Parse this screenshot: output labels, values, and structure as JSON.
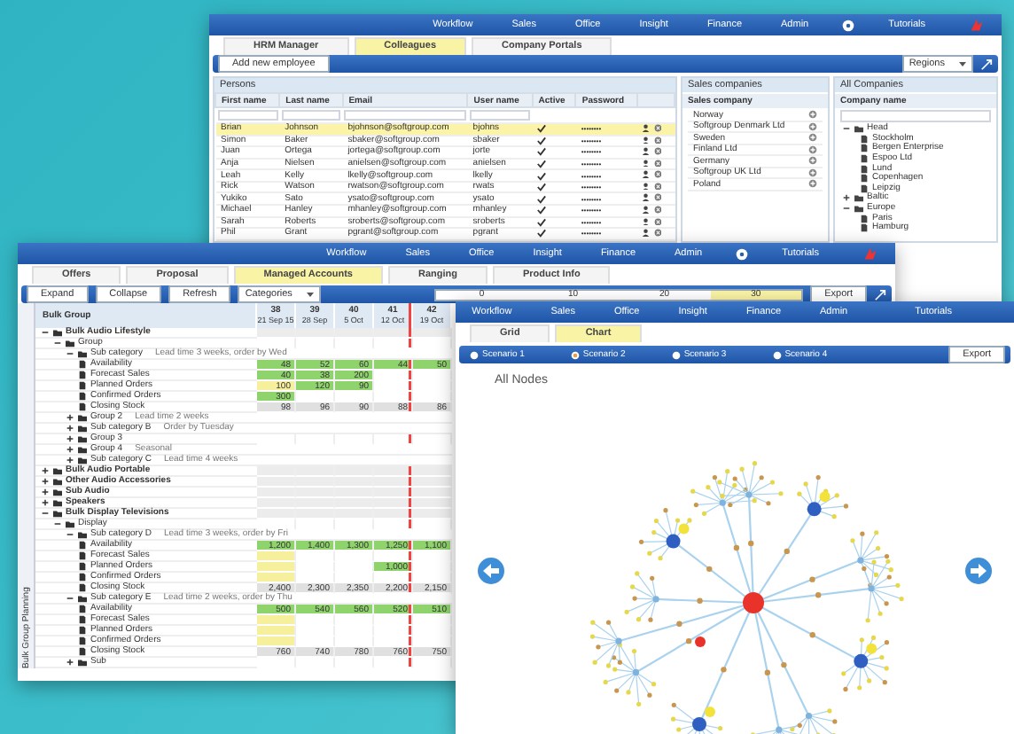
{
  "windows": [
    {
      "kind": "people",
      "menu": [
        "Workflow",
        "Sales",
        "Office",
        "Insight",
        "Finance",
        "Admin",
        "Tutorials"
      ],
      "tabs": [
        {
          "label": "HRM Manager",
          "selected": false
        },
        {
          "label": "Colleagues",
          "selected": true
        },
        {
          "label": "Company Portals",
          "selected": false
        }
      ],
      "toolbar": {
        "button": "Add new employee",
        "dropdown": "Regions"
      },
      "persons": {
        "title": "Persons",
        "columns": [
          "First name",
          "Last name",
          "Email",
          "User name",
          "Active",
          "Password"
        ],
        "rows": [
          {
            "cells": [
              "Brian",
              "Johnson",
              "bjohnson@softgroup.com",
              "bjohns"
            ],
            "active": true,
            "password": "••••••••",
            "selected": true
          },
          {
            "cells": [
              "Simon",
              "Baker",
              "sbaker@softgroup.com",
              "sbaker"
            ],
            "active": true,
            "password": "••••••••",
            "selected": false
          },
          {
            "cells": [
              "Juan",
              "Ortega",
              "jortega@softgroup.com",
              "jorte"
            ],
            "active": true,
            "password": "••••••••",
            "selected": false
          },
          {
            "cells": [
              "Anja",
              "Nielsen",
              "anielsen@softgroup.com",
              "anielsen"
            ],
            "active": true,
            "password": "••••••••",
            "selected": false
          },
          {
            "cells": [
              "Leah",
              "Kelly",
              "lkelly@softgroup.com",
              "lkelly"
            ],
            "active": true,
            "password": "••••••••",
            "selected": false
          },
          {
            "cells": [
              "Rick",
              "Watson",
              "rwatson@softgroup.com",
              "rwats"
            ],
            "active": true,
            "password": "••••••••",
            "selected": false
          },
          {
            "cells": [
              "Yukiko",
              "Sato",
              "ysato@softgroup.com",
              "ysato"
            ],
            "active": true,
            "password": "••••••••",
            "selected": false
          },
          {
            "cells": [
              "Michael",
              "Hanley",
              "mhanley@softgroup.com",
              "mhanley"
            ],
            "active": true,
            "password": "••••••••",
            "selected": false
          },
          {
            "cells": [
              "Sarah",
              "Roberts",
              "sroberts@softgroup.com",
              "sroberts"
            ],
            "active": true,
            "password": "••••••••",
            "selected": false
          },
          {
            "cells": [
              "Phil",
              "Grant",
              "pgrant@softgroup.com",
              "pgrant"
            ],
            "active": true,
            "password": "••••••••",
            "selected": false
          }
        ]
      },
      "sales": {
        "title": "Sales companies",
        "column": "Sales company",
        "items": [
          "Norway",
          "Softgroup Denmark Ltd",
          "Sweden",
          "Finland Ltd",
          "Germany",
          "Softgroup UK Ltd",
          "Poland"
        ]
      },
      "companies": {
        "title": "All Companies",
        "column": "Company name",
        "tree": [
          {
            "label": "Head",
            "expanded": true,
            "children": [
              {
                "label": "Stockholm"
              },
              {
                "label": "Bergen Enterprise"
              },
              {
                "label": "Espoo Ltd"
              },
              {
                "label": "Lund"
              },
              {
                "label": "Copenhagen"
              },
              {
                "label": "Leipzig"
              }
            ]
          },
          {
            "label": "Baltic",
            "expanded": false
          },
          {
            "label": "Europe",
            "expanded": true,
            "children": [
              {
                "label": "Paris"
              },
              {
                "label": "Hamburg"
              }
            ]
          }
        ]
      }
    },
    {
      "kind": "planner",
      "menu": [
        "Workflow",
        "Sales",
        "Office",
        "Insight",
        "Finance",
        "Admin",
        "Tutorials"
      ],
      "tabs": [
        {
          "label": "Offers",
          "selected": false
        },
        {
          "label": "Proposal",
          "selected": false
        },
        {
          "label": "Managed Accounts",
          "selected": true
        },
        {
          "label": "Ranging",
          "selected": false
        },
        {
          "label": "Product Info",
          "selected": false
        }
      ],
      "toolbar": {
        "buttons": [
          "Expand",
          "Collapse",
          "Refresh"
        ],
        "dropdown": "Categories",
        "scale": [
          "0",
          "10",
          "20",
          "30"
        ],
        "button": "Export"
      },
      "side_label": "Bulk Group Planning",
      "group_header": "Bulk Group",
      "weeks": [
        {
          "week": "38",
          "date": "21 Sep 15",
          "current": false
        },
        {
          "week": "39",
          "date": "28 Sep",
          "current": false
        },
        {
          "week": "40",
          "date": "5 Oct",
          "current": false
        },
        {
          "week": "41",
          "date": "12 Oct",
          "current": true
        },
        {
          "week": "42",
          "date": "19 Oct",
          "current": false
        }
      ],
      "rows": [
        {
          "label": "Bulk Audio Lifestyle",
          "expanded": true,
          "children": [
            {
              "label": "Group",
              "expanded": true,
              "children": [
                {
                  "label": "Sub category",
                  "note": "Lead time 3 weeks, order by Wed",
                  "expanded": true,
                  "children": [
                    {
                      "label": "Availability",
                      "cells": [
                        {
                          "value": "48",
                          "color": "#8fd36c"
                        },
                        {
                          "value": "52",
                          "color": "#8fd36c"
                        },
                        {
                          "value": "60",
                          "color": "#8fd36c"
                        },
                        {
                          "value": "44",
                          "color": "#8fd36c"
                        },
                        {
                          "value": "50",
                          "color": "#8fd36c"
                        }
                      ]
                    },
                    {
                      "label": "Forecast Sales",
                      "cells": [
                        {
                          "value": "40",
                          "color": "#8fd36c"
                        },
                        {
                          "value": "38",
                          "color": "#8fd36c"
                        },
                        {
                          "value": "200",
                          "color": "#8fd36c"
                        },
                        {
                          "color": "#ffffff"
                        },
                        {
                          "color": "#ffffff"
                        }
                      ]
                    },
                    {
                      "label": "Planned Orders",
                      "cells": [
                        {
                          "value": "100",
                          "color": "#f6ef9c"
                        },
                        {
                          "value": "120",
                          "color": "#8fd36c"
                        },
                        {
                          "value": "90",
                          "color": "#8fd36c"
                        },
                        {
                          "color": "#ffffff"
                        },
                        {
                          "color": "#ffffff"
                        }
                      ]
                    },
                    {
                      "label": "Confirmed Orders",
                      "cells": [
                        {
                          "value": "300",
                          "color": "#8fd36c"
                        },
                        {
                          "color": "#ffffff"
                        },
                        {
                          "color": "#ffffff"
                        },
                        {
                          "color": "#ffffff"
                        },
                        {
                          "color": "#ffffff"
                        }
                      ]
                    },
                    {
                      "label": "Closing Stock",
                      "cells": [
                        {
                          "value": "98",
                          "color": "#e0e0e0"
                        },
                        {
                          "value": "96",
                          "color": "#e0e0e0"
                        },
                        {
                          "value": "90",
                          "color": "#e0e0e0"
                        },
                        {
                          "value": "88",
                          "color": "#e0e0e0"
                        },
                        {
                          "value": "86",
                          "color": "#e0e0e0"
                        }
                      ]
                    }
                  ]
                },
                {
                  "label": "Group 2",
                  "note": "Lead time 2 weeks",
                  "expanded": false
                },
                {
                  "label": "Sub category B",
                  "note": "Order by Tuesday",
                  "expanded": false
                },
                {
                  "label": "Group 3",
                  "expanded": false
                },
                {
                  "label": "Group 4",
                  "note": "Seasonal",
                  "expanded": false
                },
                {
                  "label": "Sub category C",
                  "note": "Lead time 4 weeks",
                  "expanded": false
                }
              ]
            }
          ]
        },
        {
          "label": "Bulk Audio Portable",
          "expanded": false
        },
        {
          "label": "Other Audio Accessories",
          "expanded": false
        },
        {
          "label": "Sub Audio",
          "expanded": false
        },
        {
          "label": "Speakers",
          "expanded": false
        },
        {
          "label": "Bulk Display Televisions",
          "expanded": true,
          "children": [
            {
              "label": "Display",
              "expanded": true,
              "children": [
                {
                  "label": "Sub category D",
                  "note": "Lead time 3 weeks, order by Fri",
                  "expanded": true,
                  "children": [
                    {
                      "label": "Availability",
                      "cells": [
                        {
                          "value": "1,200",
                          "color": "#8fd36c"
                        },
                        {
                          "value": "1,400",
                          "color": "#8fd36c"
                        },
                        {
                          "value": "1,300",
                          "color": "#8fd36c"
                        },
                        {
                          "value": "1,250",
                          "color": "#8fd36c"
                        },
                        {
                          "value": "1,100",
                          "color": "#8fd36c"
                        }
                      ]
                    },
                    {
                      "label": "Forecast Sales",
                      "cells": [
                        {
                          "color": "#f6ef9c"
                        },
                        {
                          "color": "#ffffff"
                        },
                        {
                          "color": "#ffffff"
                        },
                        {
                          "color": "#ffffff"
                        },
                        {
                          "color": "#ffffff"
                        }
                      ]
                    },
                    {
                      "label": "Planned Orders",
                      "cells": [
                        {
                          "color": "#f6ef9c"
                        },
                        {
                          "color": "#ffffff"
                        },
                        {
                          "color": "#ffffff"
                        },
                        {
                          "value": "1,000",
                          "color": "#8fd36c"
                        },
                        {
                          "color": "#ffffff"
                        }
                      ]
                    },
                    {
                      "label": "Confirmed Orders",
                      "cells": [
                        {
                          "color": "#f6ef9c"
                        },
                        {
                          "color": "#ffffff"
                        },
                        {
                          "color": "#ffffff"
                        },
                        {
                          "color": "#ffffff"
                        },
                        {
                          "color": "#ffffff"
                        }
                      ]
                    },
                    {
                      "label": "Closing Stock",
                      "cells": [
                        {
                          "value": "2,400",
                          "color": "#e0e0e0"
                        },
                        {
                          "value": "2,300",
                          "color": "#e0e0e0"
                        },
                        {
                          "value": "2,350",
                          "color": "#e0e0e0"
                        },
                        {
                          "value": "2,200",
                          "color": "#e0e0e0"
                        },
                        {
                          "value": "2,150",
                          "color": "#e0e0e0"
                        }
                      ]
                    }
                  ]
                },
                {
                  "label": "Sub category E",
                  "note": "Lead time 2 weeks, order by Thu",
                  "expanded": true,
                  "children": [
                    {
                      "label": "Availability",
                      "cells": [
                        {
                          "value": "500",
                          "color": "#8fd36c"
                        },
                        {
                          "value": "540",
                          "color": "#8fd36c"
                        },
                        {
                          "value": "560",
                          "color": "#8fd36c"
                        },
                        {
                          "value": "520",
                          "color": "#8fd36c"
                        },
                        {
                          "value": "510",
                          "color": "#8fd36c"
                        }
                      ]
                    },
                    {
                      "label": "Forecast Sales",
                      "cells": [
                        {
                          "color": "#f6ef9c"
                        },
                        {
                          "color": "#ffffff"
                        },
                        {
                          "color": "#ffffff"
                        },
                        {
                          "color": "#ffffff"
                        },
                        {
                          "color": "#ffffff"
                        }
                      ]
                    },
                    {
                      "label": "Planned Orders",
                      "cells": [
                        {
                          "color": "#f6ef9c"
                        },
                        {
                          "color": "#ffffff"
                        },
                        {
                          "color": "#ffffff"
                        },
                        {
                          "color": "#ffffff"
                        },
                        {
                          "color": "#ffffff"
                        }
                      ]
                    },
                    {
                      "label": "Confirmed Orders",
                      "cells": [
                        {
                          "color": "#f6ef9c"
                        },
                        {
                          "color": "#ffffff"
                        },
                        {
                          "color": "#ffffff"
                        },
                        {
                          "color": "#ffffff"
                        },
                        {
                          "color": "#ffffff"
                        }
                      ]
                    },
                    {
                      "label": "Closing Stock",
                      "cells": [
                        {
                          "value": "760",
                          "color": "#e0e0e0"
                        },
                        {
                          "value": "740",
                          "color": "#e0e0e0"
                        },
                        {
                          "value": "780",
                          "color": "#e0e0e0"
                        },
                        {
                          "value": "760",
                          "color": "#e0e0e0"
                        },
                        {
                          "value": "750",
                          "color": "#e0e0e0"
                        }
                      ]
                    }
                  ]
                },
                {
                  "label": "Sub",
                  "expanded": false
                }
              ]
            }
          ]
        }
      ]
    },
    {
      "kind": "network",
      "menu": [
        "Workflow",
        "Sales",
        "Office",
        "Insight",
        "Finance",
        "Admin",
        "Tutorials"
      ],
      "tabs": [
        {
          "label": "Grid",
          "selected": false
        },
        {
          "label": "Chart",
          "selected": true
        }
      ],
      "options": [
        {
          "label": "Scenario 1",
          "selected": false
        },
        {
          "label": "Scenario 2",
          "selected": true
        },
        {
          "label": "Scenario 3",
          "selected": false
        },
        {
          "label": "Scenario 4",
          "selected": false
        }
      ],
      "export": "Export",
      "caption": "All Nodes"
    }
  ]
}
